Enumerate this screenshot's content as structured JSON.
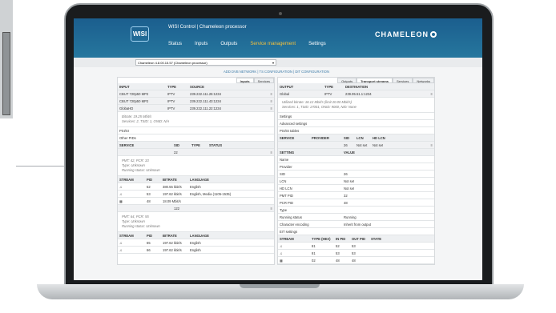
{
  "app": {
    "logo": "WISI",
    "title": "WISI Control | Chameleon processor",
    "brand": "CHAMELEON"
  },
  "nav": [
    "Status",
    "Inputs",
    "Outputs",
    "Service management",
    "Settings"
  ],
  "device_select": "Chameleon 4.8.00.15.57 (Chameleon processor)",
  "links": {
    "a": "ADD DVB NETWORK",
    "b": "TS CONFIGURATION",
    "c": "DIT CONFIGURATION"
  },
  "left": {
    "tabs": [
      "Inputs",
      "Services"
    ],
    "header": [
      "INPUT",
      "TYPE",
      "SOURCE"
    ],
    "inputs": [
      {
        "n": "CBUT 720p50 MP2",
        "t": "IPTV",
        "s": "239.222.111.26:1234"
      },
      {
        "n": "CBUT 720p50 MP2",
        "t": "IPTV",
        "s": "239.222.111.43:1234"
      },
      {
        "n": "GlobaHD",
        "t": "IPTV",
        "s": "239.222.111.22:1234"
      }
    ],
    "bitrate": "Bitrate: 19.25 Mbit/s",
    "services": "Services: 2, TSID: 1, ONID: N/A",
    "psisi": "PSI/SI",
    "pids": "Other PIDs",
    "svchdr": [
      "SERVICE",
      "SID",
      "TYPE",
      "STATUS"
    ],
    "svc1": {
      "sid": "22"
    },
    "svc1info": [
      "PMT: 42, PCR: 33",
      "Type: Unknown",
      "Running status: Unknown"
    ],
    "streamhdr": [
      "STREAM",
      "PID",
      "BITRATE",
      "LANGUAGE"
    ],
    "streams1": [
      {
        "pid": "52",
        "br": "380.55 kbit/s",
        "lang": "English"
      },
      {
        "pid": "53",
        "br": "197.62 kbit/s",
        "lang": "English, Media (1105-1535)"
      },
      {
        "pid": "48",
        "br": "18.09 Mbit/s",
        "lang": ""
      }
    ],
    "svc2": {
      "sid": "122"
    },
    "svc2info": [
      "PMT: 64, PCR: 55",
      "Type: Unknown",
      "Running status: Unknown"
    ],
    "streams2": [
      {
        "pid": "65",
        "br": "197.62 kbit/s",
        "lang": "English"
      },
      {
        "pid": "66",
        "br": "197.62 kbit/s",
        "lang": "English"
      }
    ]
  },
  "right": {
    "tabs": [
      "Outputs",
      "Transport streams",
      "Services",
      "Networks"
    ],
    "header": [
      "OUTPUT",
      "TYPE",
      "DESTINATION"
    ],
    "output": {
      "n": "Global",
      "t": "IPTV",
      "d": "239.95.51.1:1234"
    },
    "info1": "Utilized bitrate: 18.12 Mbit/s (limit 20.00 Mbit/s)",
    "info2": "Services: 1, TSID: 17001, ONID: 9000, NID: None",
    "sections": [
      "Settings",
      "Advanced settings",
      "PSI/SI tables"
    ],
    "svchdr": [
      "SERVICE",
      "PROVIDER",
      "SID",
      "LCN",
      "HD LCN"
    ],
    "svcrow": {
      "sid": "26",
      "lcn": "Not set",
      "hd": "Not set"
    },
    "setHdr": [
      "SETTING",
      "VALUE"
    ],
    "settings": [
      [
        "Name",
        ""
      ],
      [
        "Provider",
        ""
      ],
      [
        "SID",
        "26"
      ],
      [
        "LCN",
        "Not set"
      ],
      [
        "HD LCN",
        "Not set"
      ],
      [
        "PMT PID",
        "32"
      ],
      [
        "PCR PID",
        "48"
      ],
      [
        "Type",
        ""
      ],
      [
        "Running status",
        "Running"
      ],
      [
        "Character encoding",
        "Inherit from output"
      ]
    ],
    "eit": "EIT settings",
    "strhdr": [
      "STREAM",
      "TYPE (HEX)",
      "IN PID",
      "OUT PID",
      "STATE"
    ],
    "streams": [
      [
        "81",
        "52",
        "53"
      ],
      [
        "81",
        "53",
        "53"
      ],
      [
        "02",
        "48",
        "48"
      ]
    ]
  }
}
